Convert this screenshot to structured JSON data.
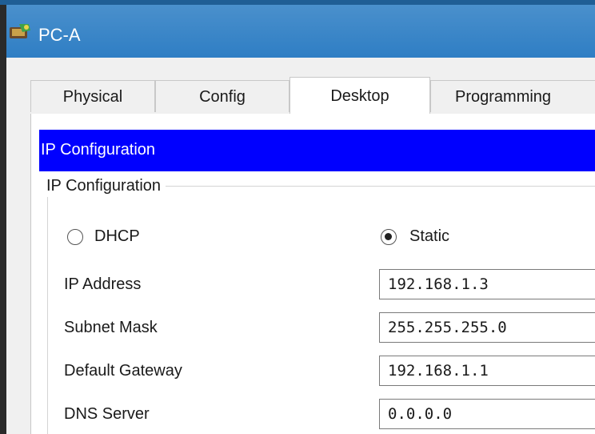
{
  "window": {
    "title": "PC-A",
    "icon": "pc-icon"
  },
  "tabs": [
    {
      "label": "Physical",
      "active": false
    },
    {
      "label": "Config",
      "active": false
    },
    {
      "label": "Desktop",
      "active": true
    },
    {
      "label": "Programming",
      "active": false
    }
  ],
  "panel": {
    "header": "IP Configuration",
    "header_color": "#0000ff",
    "group_title": "IP Configuration"
  },
  "mode": {
    "dhcp_label": "DHCP",
    "static_label": "Static",
    "selected": "Static"
  },
  "fields": {
    "ip_address": {
      "label": "IP Address",
      "value": "192.168.1.3"
    },
    "subnet_mask": {
      "label": "Subnet Mask",
      "value": "255.255.255.0"
    },
    "default_gateway": {
      "label": "Default Gateway",
      "value": "192.168.1.1"
    },
    "dns_server": {
      "label": "DNS Server",
      "value": "0.0.0.0"
    }
  }
}
